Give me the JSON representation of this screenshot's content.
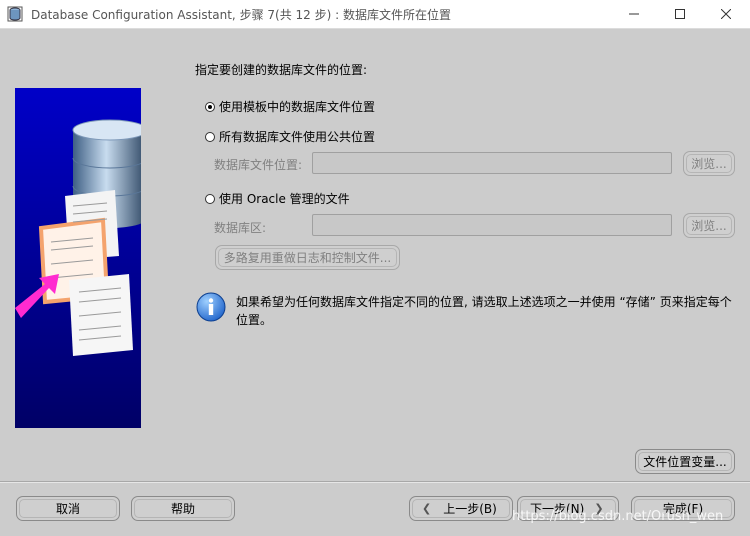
{
  "window": {
    "title": "Database Configuration Assistant, 步骤 7(共 12 步) : 数据库文件所在位置",
    "icon": "database-app-icon",
    "controls": [
      "minimize-icon",
      "maximize-icon",
      "close-icon"
    ]
  },
  "main": {
    "prompt": "指定要创建的数据库文件的位置:",
    "options": [
      {
        "label": "使用模板中的数据库文件位置",
        "selected": true
      },
      {
        "label": "所有数据库文件使用公共位置",
        "selected": false
      },
      {
        "label": "使用 Oracle 管理的文件",
        "selected": false
      }
    ],
    "common_location": {
      "label": "数据库文件位置:",
      "value": "",
      "browse_label": "浏览..."
    },
    "db_area": {
      "label": "数据库区:",
      "value": "",
      "browse_label": "浏览..."
    },
    "multiplex_button": "多路复用重做日志和控制文件...",
    "info": {
      "icon": "info-icon",
      "text": "如果希望为任何数据库文件指定不同的位置, 请选取上述选项之一并使用 “存储” 页来指定每个位置。"
    },
    "file_location_vars_button": "文件位置变量..."
  },
  "footer": {
    "cancel": "取消",
    "help": "帮助",
    "back": "上一步(B)",
    "next": "下一步(N)",
    "finish": "完成(F)"
  },
  "watermark": "https://blog.csdn.net/Orush_wen"
}
